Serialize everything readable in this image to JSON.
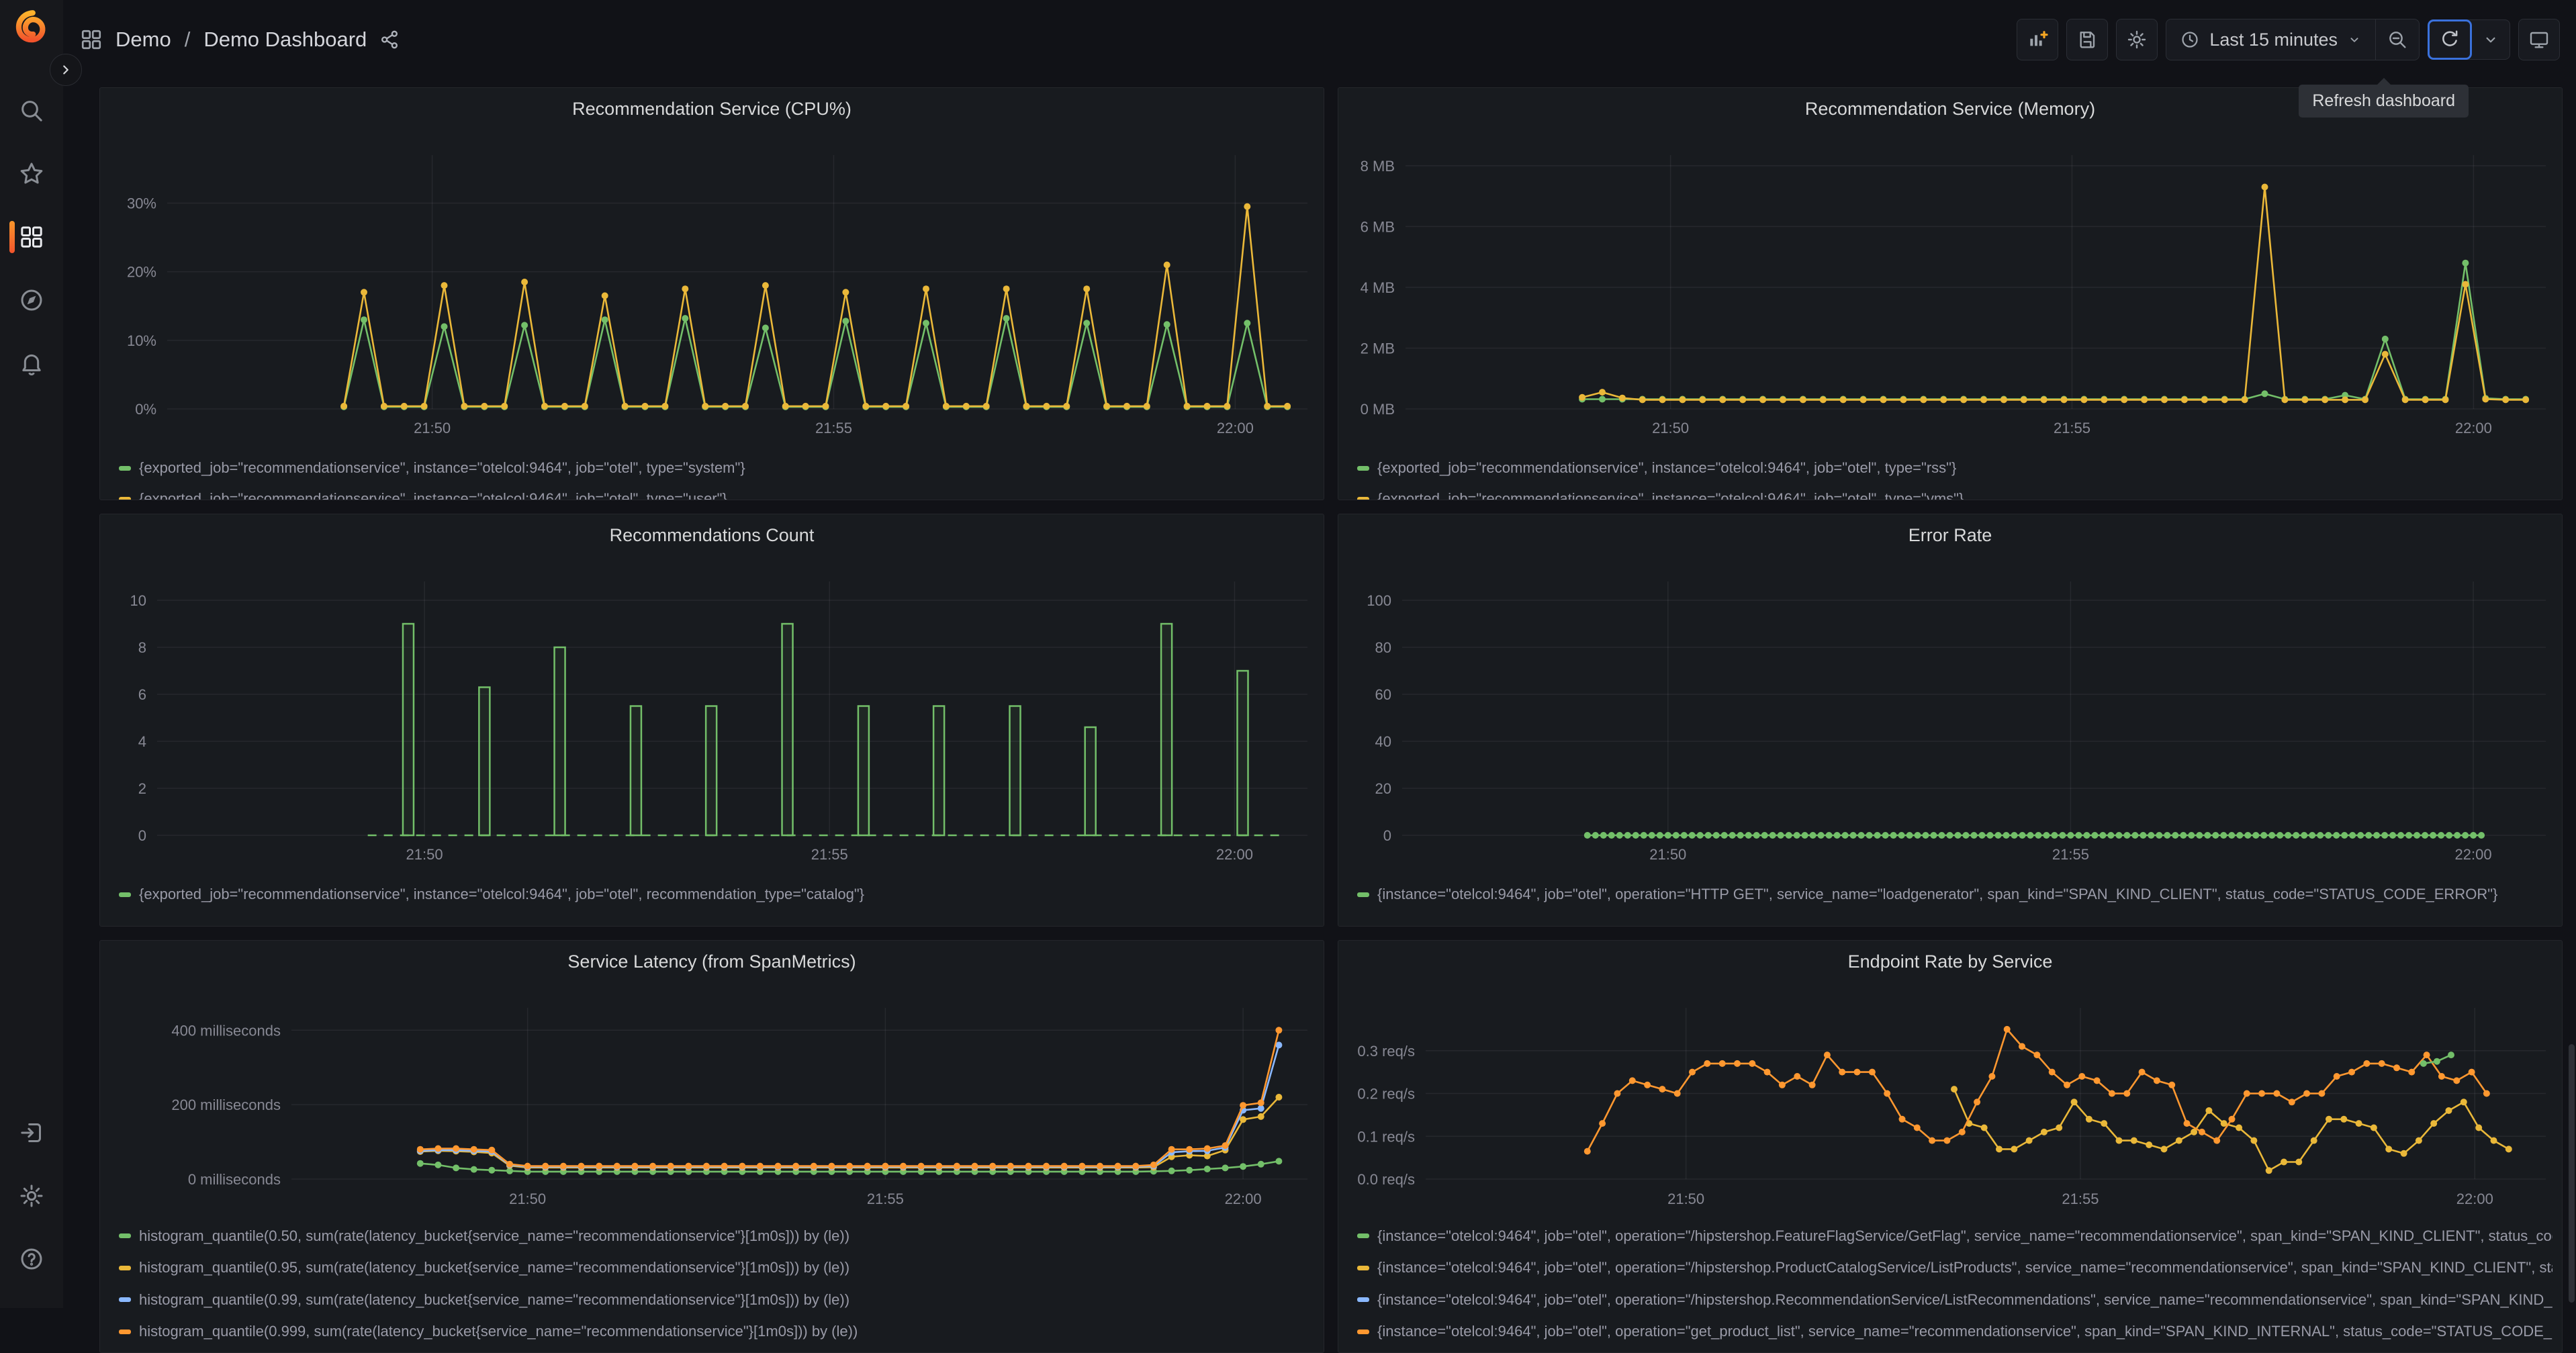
{
  "colors": {
    "green": "#73BF69",
    "yellow": "#EAB839",
    "blue": "#8AB8FF",
    "orange": "#FF9830",
    "accent_blue": "#3A71DC",
    "active_orange_gradient": [
      "#F8962B",
      "#F2542C"
    ]
  },
  "sidebar": {
    "icons": [
      "grafana-logo",
      "search-icon",
      "star-icon",
      "dashboards-icon",
      "explore-compass-icon",
      "alerting-bell-icon",
      "sign-in-icon",
      "settings-gear-icon",
      "help-icon"
    ],
    "active_item": "dashboards"
  },
  "header": {
    "breadcrumb": {
      "folder": "Demo",
      "separator": "/",
      "dashboard": "Demo Dashboard"
    },
    "toolbar": {
      "icons": [
        "add-panel-icon",
        "save-icon",
        "settings-gear-icon",
        "clock-icon",
        "zoom-out-icon",
        "refresh-icon",
        "caret-down-icon",
        "tv-icon"
      ],
      "time_range": "Last 15 minutes",
      "tooltip": "Refresh dashboard"
    }
  },
  "xaxis": {
    "domain": [
      46.7,
      60.9
    ],
    "ticks": [
      {
        "v": 50,
        "label": "21:50"
      },
      {
        "v": 55,
        "label": "21:55"
      },
      {
        "v": 60,
        "label": "22:00"
      }
    ]
  },
  "panels": [
    {
      "title": "Recommendation Service (CPU%)",
      "type": "line",
      "ymax": 37,
      "yticks": [
        {
          "v": 0,
          "label": "0%"
        },
        {
          "v": 10,
          "label": "10%"
        },
        {
          "v": 20,
          "label": "20%"
        },
        {
          "v": 30,
          "label": "30%"
        }
      ],
      "series": [
        {
          "color": "green",
          "pattern": {
            "start": 48.9,
            "step": 0.25,
            "values": [
              0.3,
              13,
              0.3,
              0.3,
              0.3,
              12,
              0.3,
              0.3,
              0.3,
              12.2,
              0.3,
              0.3,
              0.3,
              13,
              0.3,
              0.3,
              0.3,
              13.2,
              0.3,
              0.3,
              0.3,
              11.8,
              0.3,
              0.3,
              0.3,
              12.8,
              0.3,
              0.3,
              0.3,
              12.5,
              0.3,
              0.3,
              0.3,
              13.2,
              0.3,
              0.3,
              0.3,
              12.5,
              0.3,
              0.3,
              0.3,
              12.3,
              0.3,
              0.3,
              0.3,
              12.5,
              0.3,
              0.3,
              0.3,
              0.3
            ]
          }
        },
        {
          "color": "yellow",
          "pattern": {
            "start": 48.9,
            "step": 0.25,
            "values": [
              0.4,
              17,
              0.4,
              0.4,
              0.4,
              18,
              0.4,
              0.4,
              0.4,
              18.5,
              0.4,
              0.4,
              0.4,
              16.5,
              0.4,
              0.4,
              0.4,
              17.5,
              0.4,
              0.4,
              0.4,
              18,
              0.4,
              0.4,
              0.4,
              17,
              0.4,
              0.4,
              0.4,
              17.5,
              0.4,
              0.4,
              0.4,
              17.5,
              0.4,
              0.4,
              0.4,
              17.5,
              0.4,
              0.4,
              0.4,
              21,
              0.4,
              0.4,
              0.4,
              29.5,
              0.4,
              0.4,
              0.4,
              0.4
            ]
          }
        }
      ],
      "legend": [
        {
          "color": "green",
          "text": "{exported_job=\"recommendationservice\", instance=\"otelcol:9464\", job=\"otel\", type=\"system\"}"
        },
        {
          "color": "yellow",
          "text": "{exported_job=\"recommendationservice\", instance=\"otelcol:9464\", job=\"otel\", type=\"user\"}"
        }
      ]
    },
    {
      "title": "Recommendation Service (Memory)",
      "type": "line",
      "ymax": 8.35,
      "yticks": [
        {
          "v": 0,
          "label": "0 MB"
        },
        {
          "v": 2,
          "label": "2 MB"
        },
        {
          "v": 4,
          "label": "4 MB"
        },
        {
          "v": 6,
          "label": "6 MB"
        },
        {
          "v": 8,
          "label": "8 MB"
        }
      ],
      "series": [
        {
          "color": "green",
          "pattern": {
            "start": 48.9,
            "step": 0.25,
            "values": [
              0.32,
              0.32,
              0.32,
              0.32,
              0.32,
              0.32,
              0.32,
              0.32,
              0.32,
              0.32,
              0.32,
              0.32,
              0.32,
              0.32,
              0.32,
              0.32,
              0.32,
              0.32,
              0.32,
              0.32,
              0.32,
              0.32,
              0.32,
              0.32,
              0.32,
              0.32,
              0.32,
              0.32,
              0.32,
              0.32,
              0.32,
              0.32,
              0.32,
              0.32,
              0.5,
              0.32,
              0.32,
              0.32,
              0.45,
              0.32,
              2.3,
              0.32,
              0.32,
              0.32,
              4.8,
              0.35,
              0.32,
              0.32,
              0.32,
              0.32
            ]
          }
        },
        {
          "color": "yellow",
          "pattern": {
            "start": 48.9,
            "step": 0.25,
            "values": [
              0.38,
              0.55,
              0.36,
              0.3,
              0.3,
              0.3,
              0.3,
              0.3,
              0.3,
              0.3,
              0.3,
              0.3,
              0.3,
              0.3,
              0.3,
              0.3,
              0.3,
              0.3,
              0.3,
              0.3,
              0.3,
              0.3,
              0.3,
              0.3,
              0.3,
              0.3,
              0.3,
              0.3,
              0.3,
              0.3,
              0.3,
              0.3,
              0.3,
              0.3,
              7.3,
              0.3,
              0.3,
              0.3,
              0.3,
              0.3,
              1.8,
              0.3,
              0.3,
              0.3,
              4.1,
              0.32,
              0.3,
              0.3,
              0.3,
              0.3
            ]
          }
        }
      ],
      "legend": [
        {
          "color": "green",
          "text": "{exported_job=\"recommendationservice\", instance=\"otelcol:9464\", job=\"otel\", type=\"rss\"}"
        },
        {
          "color": "yellow",
          "text": "{exported_job=\"recommendationservice\", instance=\"otelcol:9464\", job=\"otel\", type=\"vms\"}"
        }
      ]
    },
    {
      "title": "Recommendations Count",
      "type": "bar",
      "ymax": 10.8,
      "yticks": [
        {
          "v": 0,
          "label": "0"
        },
        {
          "v": 2,
          "label": "2"
        },
        {
          "v": 4,
          "label": "4"
        },
        {
          "v": 6,
          "label": "6"
        },
        {
          "v": 8,
          "label": "8"
        },
        {
          "v": 10,
          "label": "10"
        }
      ],
      "bars": [
        [
          49.8,
          9
        ],
        [
          50.74,
          6.3
        ],
        [
          51.67,
          8
        ],
        [
          52.61,
          5.5
        ],
        [
          53.54,
          5.5
        ],
        [
          54.48,
          9
        ],
        [
          55.42,
          5.5
        ],
        [
          56.35,
          5.5
        ],
        [
          57.29,
          5.5
        ],
        [
          58.22,
          4.6
        ],
        [
          59.16,
          9
        ],
        [
          60.1,
          7
        ]
      ],
      "bar_color": "green",
      "baseline": {
        "from": 49.3,
        "to": 60.55
      },
      "legend": [
        {
          "color": "green",
          "text": "{exported_job=\"recommendationservice\", instance=\"otelcol:9464\", job=\"otel\", recommendation_type=\"catalog\"}"
        }
      ]
    },
    {
      "title": "Error Rate",
      "type": "line",
      "ymax": 108,
      "yticks": [
        {
          "v": 0,
          "label": "0"
        },
        {
          "v": 20,
          "label": "20"
        },
        {
          "v": 40,
          "label": "40"
        },
        {
          "v": 60,
          "label": "60"
        },
        {
          "v": 80,
          "label": "80"
        },
        {
          "v": 100,
          "label": "100"
        }
      ],
      "series": [
        {
          "color": "green",
          "flat": {
            "from": 49.0,
            "to": 60.1,
            "step": 0.1,
            "value": 0
          }
        }
      ],
      "legend": [
        {
          "color": "green",
          "text": "{instance=\"otelcol:9464\", job=\"otel\", operation=\"HTTP GET\", service_name=\"loadgenerator\", span_kind=\"SPAN_KIND_CLIENT\", status_code=\"STATUS_CODE_ERROR\"}"
        }
      ]
    },
    {
      "title": "Service Latency (from SpanMetrics)",
      "type": "line",
      "ymax": 460,
      "yticks": [
        {
          "v": 0,
          "label": "0 milliseconds"
        },
        {
          "v": 200,
          "label": "200 milliseconds"
        },
        {
          "v": 400,
          "label": "400 milliseconds"
        }
      ],
      "series": [
        {
          "color": "green",
          "pattern": {
            "start": 48.5,
            "step": 0.25,
            "values": [
              42,
              38,
              30,
              26,
              24,
              22,
              20,
              20,
              20,
              20,
              20,
              20,
              20,
              20,
              20,
              20,
              20,
              20,
              20,
              20,
              20,
              20,
              20,
              20,
              20,
              20,
              20,
              20,
              20,
              20,
              20,
              20,
              20,
              20,
              20,
              20,
              20,
              20,
              20,
              20,
              20,
              21,
              22,
              24,
              27,
              30,
              34,
              40,
              48
            ]
          }
        },
        {
          "color": "yellow",
          "pattern": {
            "start": 48.5,
            "step": 0.25,
            "values": [
              74,
              76,
              75,
              73,
              70,
              36,
              31,
              31,
              31,
              31,
              31,
              31,
              31,
              31,
              31,
              31,
              31,
              31,
              31,
              31,
              31,
              31,
              31,
              31,
              31,
              31,
              31,
              31,
              31,
              31,
              31,
              31,
              31,
              31,
              31,
              31,
              31,
              31,
              31,
              31,
              31,
              32,
              60,
              64,
              62,
              78,
              160,
              168,
              220
            ]
          }
        },
        {
          "color": "blue",
          "pattern": {
            "start": 48.5,
            "step": 0.25,
            "values": [
              76,
              78,
              78,
              76,
              74,
              38,
              33,
              33,
              33,
              33,
              33,
              33,
              33,
              33,
              33,
              33,
              33,
              33,
              33,
              33,
              33,
              33,
              33,
              33,
              33,
              33,
              33,
              33,
              33,
              33,
              33,
              33,
              33,
              33,
              33,
              33,
              33,
              33,
              33,
              33,
              33,
              35,
              72,
              75,
              76,
              85,
              185,
              190,
              360
            ]
          }
        },
        {
          "color": "orange",
          "pattern": {
            "start": 48.5,
            "step": 0.25,
            "values": [
              80,
              82,
              82,
              80,
              78,
              40,
              35,
              35,
              35,
              35,
              35,
              35,
              35,
              35,
              35,
              35,
              35,
              35,
              35,
              35,
              35,
              35,
              35,
              35,
              35,
              35,
              35,
              35,
              35,
              35,
              35,
              35,
              35,
              35,
              35,
              35,
              35,
              35,
              35,
              35,
              35,
              38,
              80,
              80,
              82,
              90,
              198,
              205,
              400
            ]
          }
        }
      ],
      "legend": [
        {
          "color": "green",
          "text": "histogram_quantile(0.50, sum(rate(latency_bucket{service_name=\"recommendationservice\"}[1m0s])) by (le))"
        },
        {
          "color": "yellow",
          "text": "histogram_quantile(0.95, sum(rate(latency_bucket{service_name=\"recommendationservice\"}[1m0s])) by (le))"
        },
        {
          "color": "blue",
          "text": "histogram_quantile(0.99, sum(rate(latency_bucket{service_name=\"recommendationservice\"}[1m0s])) by (le))"
        },
        {
          "color": "orange",
          "text": "histogram_quantile(0.999, sum(rate(latency_bucket{service_name=\"recommendationservice\"}[1m0s])) by (le))"
        }
      ]
    },
    {
      "title": "Endpoint Rate by Service",
      "type": "line",
      "ymax": 0.4,
      "yticks": [
        {
          "v": 0,
          "label": "0.0 req/s"
        },
        {
          "v": 0.1,
          "label": "0.1 req/s"
        },
        {
          "v": 0.2,
          "label": "0.2 req/s"
        },
        {
          "v": 0.3,
          "label": "0.3 req/s"
        }
      ],
      "series": [
        {
          "color": "yellow",
          "pattern": {
            "start": 53.4,
            "step": 0.19,
            "values": [
              0.21,
              0.13,
              0.12,
              0.07,
              0.07,
              0.09,
              0.11,
              0.12,
              0.18,
              0.14,
              0.13,
              0.09,
              0.09,
              0.08,
              0.07,
              0.09,
              0.11,
              0.16,
              0.13,
              0.12,
              0.09,
              0.02,
              0.04,
              0.04,
              0.09,
              0.14,
              0.14,
              0.13,
              0.12,
              0.07,
              0.06,
              0.09,
              0.13,
              0.16,
              0.18,
              0.12,
              0.09,
              0.07
            ]
          }
        },
        {
          "color": "orange",
          "pattern": {
            "start": 48.75,
            "step": 0.19,
            "values": [
              0.065,
              0.13,
              0.2,
              0.23,
              0.22,
              0.21,
              0.2,
              0.25,
              0.27,
              0.27,
              0.27,
              0.27,
              0.25,
              0.22,
              0.24,
              0.22,
              0.29,
              0.25,
              0.25,
              0.25,
              0.2,
              0.14,
              0.12,
              0.09,
              0.09,
              0.11,
              0.18,
              0.24,
              0.35,
              0.31,
              0.29,
              0.25,
              0.22,
              0.24,
              0.23,
              0.2,
              0.2,
              0.25,
              0.23,
              0.22,
              0.13,
              0.11,
              0.09,
              0.14,
              0.2,
              0.2,
              0.2,
              0.18,
              0.2,
              0.2,
              0.24,
              0.25,
              0.27,
              0.27,
              0.26,
              0.25,
              0.29,
              0.24,
              0.23,
              0.25,
              0.2
            ]
          }
        },
        {
          "color": "green",
          "points": [
            [
              59.35,
              0.27
            ],
            [
              59.52,
              0.275
            ],
            [
              59.7,
              0.29
            ]
          ]
        }
      ],
      "legend": [
        {
          "color": "green",
          "text": "{instance=\"otelcol:9464\", job=\"otel\", operation=\"/hipstershop.FeatureFlagService/GetFlag\", service_name=\"recommendationservice\", span_kind=\"SPAN_KIND_CLIENT\", status_code=\"STATUS_CODE_UNSET\"}"
        },
        {
          "color": "yellow",
          "text": "{instance=\"otelcol:9464\", job=\"otel\", operation=\"/hipstershop.ProductCatalogService/ListProducts\", service_name=\"recommendationservice\", span_kind=\"SPAN_KIND_CLIENT\", status_code=\"STATUS_CODE_UNSET\"}"
        },
        {
          "color": "blue",
          "text": "{instance=\"otelcol:9464\", job=\"otel\", operation=\"/hipstershop.RecommendationService/ListRecommendations\", service_name=\"recommendationservice\", span_kind=\"SPAN_KIND_SERVER\", status_code=\"STATUS_CODE_UNSET\"}"
        },
        {
          "color": "orange",
          "text": "{instance=\"otelcol:9464\", job=\"otel\", operation=\"get_product_list\", service_name=\"recommendationservice\", span_kind=\"SPAN_KIND_INTERNAL\", status_code=\"STATUS_CODE_UNSET\"}"
        }
      ]
    }
  ]
}
